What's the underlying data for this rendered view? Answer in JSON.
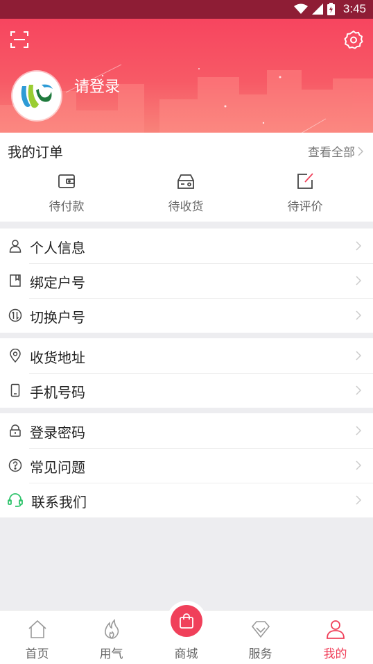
{
  "status_bar": {
    "time": "3:45"
  },
  "header": {
    "login_label": "请登录"
  },
  "orders": {
    "title": "我的订单",
    "view_all": "查看全部",
    "items": [
      {
        "label": "待付款",
        "icon": "wallet-icon"
      },
      {
        "label": "待收货",
        "icon": "delivery-box-icon"
      },
      {
        "label": "待评价",
        "icon": "edit-review-icon"
      }
    ]
  },
  "menu": {
    "group1": [
      {
        "label": "个人信息",
        "icon": "person-icon"
      },
      {
        "label": "绑定户号",
        "icon": "bookmark-icon"
      },
      {
        "label": "切换户号",
        "icon": "switch-icon"
      }
    ],
    "group2": [
      {
        "label": "收货地址",
        "icon": "location-pin-icon"
      },
      {
        "label": "手机号码",
        "icon": "phone-icon"
      }
    ],
    "group3": [
      {
        "label": "登录密码",
        "icon": "lock-icon"
      },
      {
        "label": "常见问题",
        "icon": "question-icon"
      },
      {
        "label": "联系我们",
        "icon": "headset-icon"
      }
    ]
  },
  "tabbar": {
    "tabs": [
      {
        "label": "首页",
        "icon": "home-icon"
      },
      {
        "label": "用气",
        "icon": "flame-icon"
      },
      {
        "label": "商城",
        "icon": "shopping-bag-icon"
      },
      {
        "label": "服务",
        "icon": "diamond-icon"
      },
      {
        "label": "我的",
        "icon": "user-icon"
      }
    ],
    "active_tab": "我的"
  },
  "colors": {
    "accent": "#f0405a",
    "status_bar": "#8e1d35",
    "header_top": "#f7455f"
  }
}
